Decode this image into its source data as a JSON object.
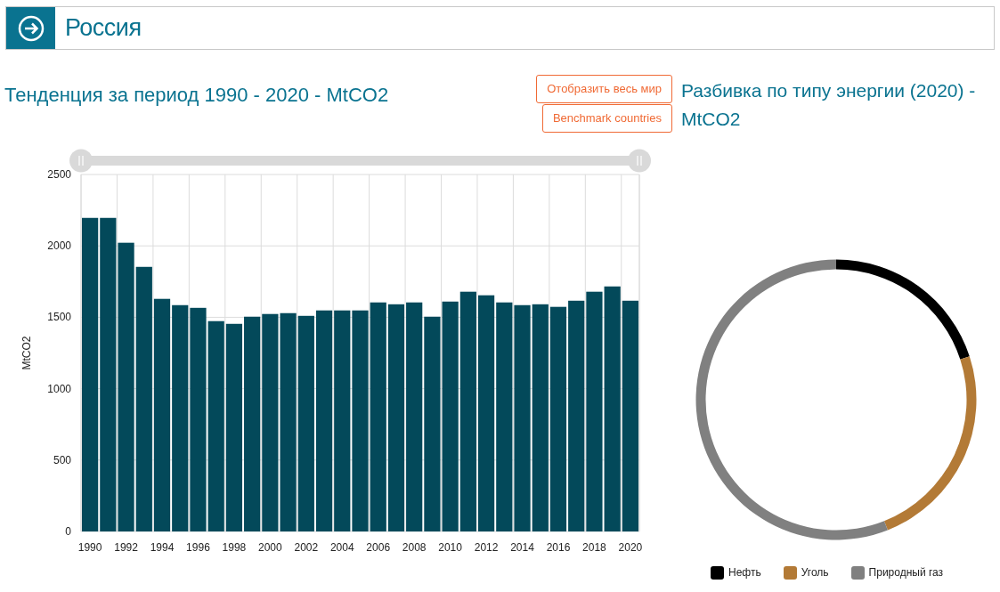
{
  "header": {
    "title": "Россия"
  },
  "trend": {
    "title": "Тенденция за период 1990 - 2020 - MtCO2",
    "buttons": [
      "Отобразить весь мир",
      "Benchmark countries"
    ],
    "chart_data": {
      "type": "bar",
      "ylabel": "MtCO2",
      "x": [
        1990,
        1991,
        1992,
        1993,
        1994,
        1995,
        1996,
        1997,
        1998,
        1999,
        2000,
        2001,
        2002,
        2003,
        2004,
        2005,
        2006,
        2007,
        2008,
        2009,
        2010,
        2011,
        2012,
        2013,
        2014,
        2015,
        2016,
        2017,
        2018,
        2019,
        2020
      ],
      "grid": true,
      "xlim": [
        1989.5,
        2020.5
      ],
      "series": [
        {
          "color": "#03495a",
          "values": [
            2196,
            2196,
            2022,
            1853,
            1629,
            1585,
            1566,
            1473,
            1454,
            1504,
            1523,
            1529,
            1510,
            1548,
            1548,
            1548,
            1604,
            1591,
            1604,
            1504,
            1610,
            1679,
            1654,
            1604,
            1585,
            1591,
            1573,
            1616,
            1679,
            1716,
            1616
          ]
        }
      ],
      "ylim": [
        0,
        2500
      ],
      "yticks": [
        0,
        500,
        1000,
        1500,
        2000,
        2500
      ],
      "xticks": [
        1990,
        1992,
        1994,
        1996,
        1998,
        2000,
        2002,
        2004,
        2006,
        2008,
        2010,
        2012,
        2014,
        2016,
        2018,
        2020
      ]
    }
  },
  "breakdown": {
    "title": "Разбивка по типу энергии (2020) - MtCO2",
    "chart_data": {
      "type": "donut",
      "categories": [
        "Нефть",
        "Уголь",
        "Природный газ"
      ],
      "values": [
        20,
        24,
        56
      ],
      "colors": [
        "#000000",
        "#b37a36",
        "#808080"
      ]
    }
  }
}
